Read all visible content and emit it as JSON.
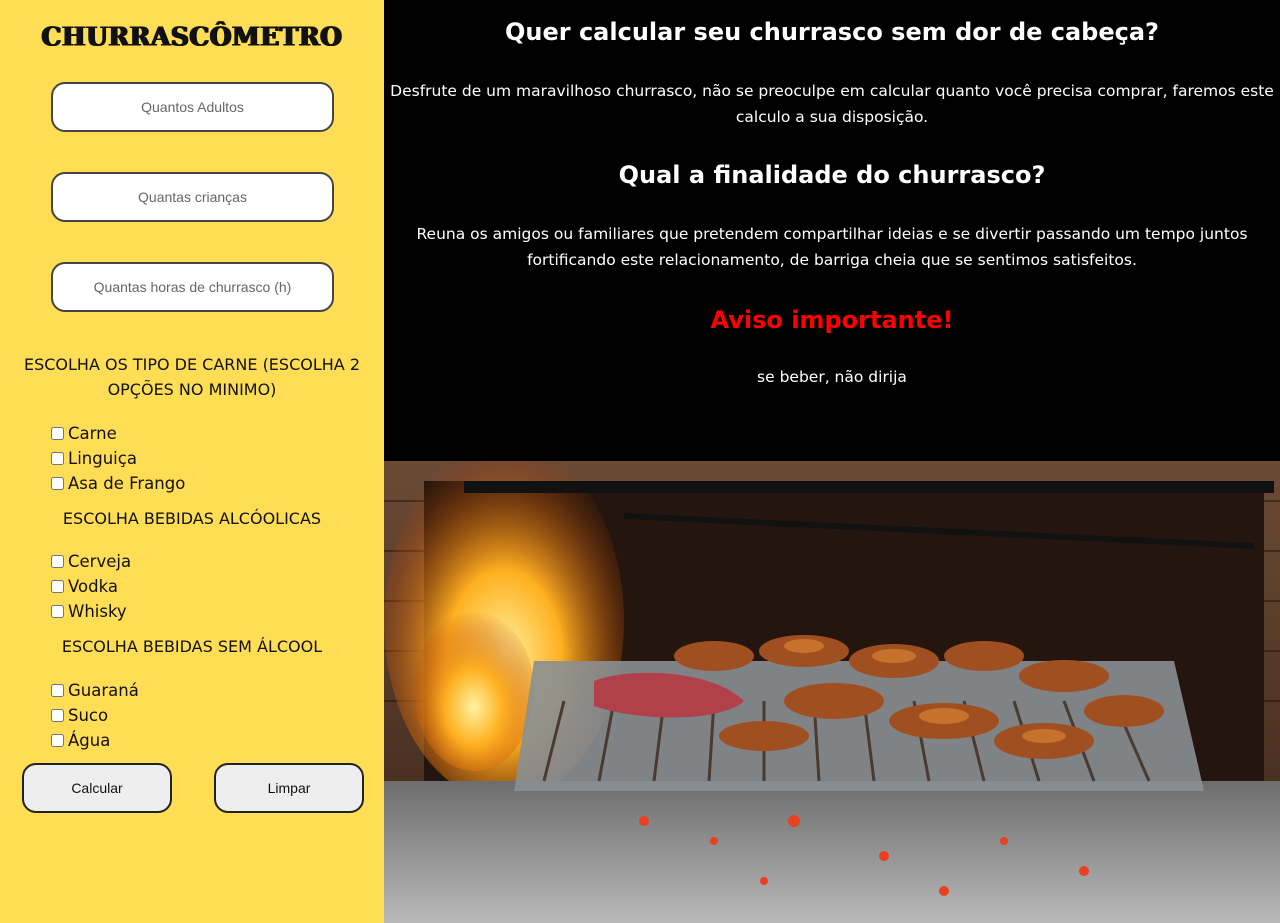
{
  "sidebar": {
    "title": "CHURRASCÔMETRO",
    "fields": {
      "adultos_placeholder": "Quantos Adultos",
      "criancas_placeholder": "Quantas crianças",
      "horas_placeholder": "Quantas horas de churrasco (h)"
    },
    "carne_label": "ESCOLHA OS TIPO DE CARNE (ESCOLHA 2 OPÇÕES NO MINIMO)",
    "carnes": [
      "Carne",
      "Linguiça",
      "Asa de Frango"
    ],
    "alcoolicas_label": "ESCOLHA BEBIDAS ALCÓOLICAS",
    "alcoolicas": [
      "Cerveja",
      "Vodka",
      "Whisky"
    ],
    "sem_alcool_label": "ESCOLHA BEBIDAS SEM ÁLCOOL",
    "sem_alcool": [
      "Guaraná",
      "Suco",
      "Água"
    ],
    "calcular_label": "Calcular",
    "limpar_label": "Limpar"
  },
  "main": {
    "heading1": "Quer calcular seu churrasco sem dor de cabeça?",
    "paragraph1": "Desfrute de um maravilhoso churrasco, não se preoculpe em calcular quanto você precisa comprar, faremos este calculo a sua disposição.",
    "heading2": "Qual a finalidade do churrasco?",
    "paragraph2": "Reuna os amigos ou familiares que pretendem compartilhar ideias e se divertir passando um tempo juntos fortificando este relacionamento, de barriga cheia que se sentimos satisfeitos.",
    "heading3": "Aviso importante!",
    "paragraph3": "se beber, não dirija"
  },
  "colors": {
    "sidebar_bg": "#ffdd55",
    "main_bg": "#000000",
    "warning": "#ff0000"
  }
}
